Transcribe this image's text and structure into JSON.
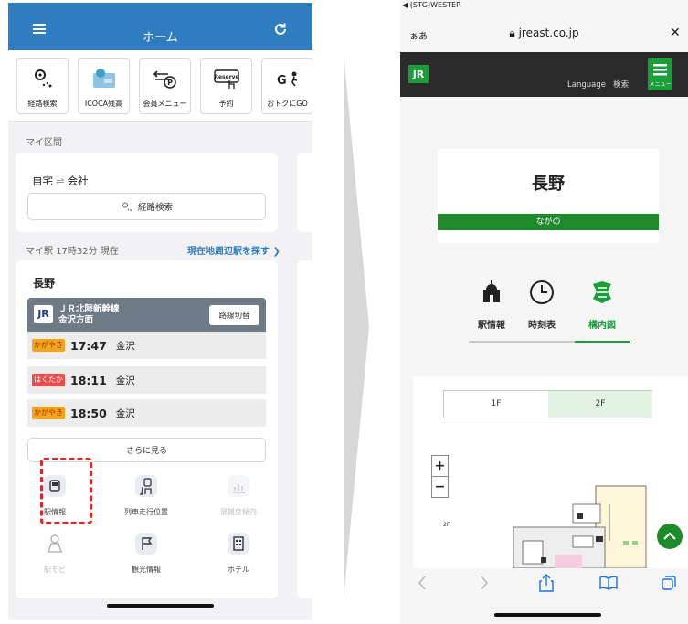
{
  "left_app": {
    "header": {
      "title": "ホーム"
    },
    "shortcuts": [
      {
        "label": "経路検索",
        "icon": "route-search-icon"
      },
      {
        "label": "ICOCA残高",
        "icon": "icoca-card-icon"
      },
      {
        "label": "会員メニュー",
        "icon": "member-menu-icon"
      },
      {
        "label": "予約",
        "icon": "reserve-icon"
      },
      {
        "label": "おトクにGO",
        "icon": "deal-go-icon"
      }
    ],
    "reserve_icon_text": "Reserve",
    "my_section": {
      "label": "マイ区間",
      "from": "自宅",
      "to": "会社",
      "arrow": "⇌",
      "route_button": "経路検索"
    },
    "my_station": {
      "label": "マイ駅",
      "time": "17時32分 現在",
      "nearby_link": "現在地周辺駅を探す"
    },
    "station": {
      "name": "長野",
      "line_name": "ＪＲ北陸新幹線",
      "direction": "金沢方面",
      "switch_button": "路線切替",
      "trains": [
        {
          "type": "かがやき",
          "time": "17:47",
          "dest": "金沢"
        },
        {
          "type": "はくたか",
          "time": "18:11",
          "dest": "金沢"
        },
        {
          "type": "かがやき",
          "time": "18:50",
          "dest": "金沢"
        }
      ],
      "more_button": "さらに見る"
    },
    "functions": [
      {
        "label": "駅情報",
        "icon": "station-info-icon",
        "enabled": true
      },
      {
        "label": "列車走行位置",
        "icon": "train-position-icon",
        "enabled": true
      },
      {
        "label": "混雑度傾向",
        "icon": "congestion-chart-icon",
        "enabled": false
      },
      {
        "label": "駅モビ",
        "icon": "eki-mobi-icon",
        "enabled": false
      },
      {
        "label": "観光情報",
        "icon": "sightseeing-flag-icon",
        "enabled": true
      },
      {
        "label": "ホテル",
        "icon": "hotel-icon",
        "enabled": true
      }
    ]
  },
  "right_browser": {
    "status_text": "◀ (STG)WESTER",
    "aa_label": "ぁあ",
    "url": "jreast.co.jp",
    "nav": {
      "language": "Language",
      "search": "検索",
      "menu": "メニュー"
    },
    "station_name": "長野",
    "station_kana": "ながの",
    "tabs": [
      {
        "label": "駅情報",
        "icon": "station-building-icon",
        "active": false
      },
      {
        "label": "時刻表",
        "icon": "clock-icon",
        "active": false
      },
      {
        "label": "構内図",
        "icon": "floor-map-icon",
        "active": true
      }
    ],
    "floors": [
      {
        "label": "1F",
        "active": false
      },
      {
        "label": "2F",
        "active": true
      }
    ],
    "zoom_in": "+",
    "zoom_out": "−",
    "map_floor_label": "2F"
  },
  "colors": {
    "app_blue": "#2f7dc0",
    "jr_green": "#1a9e3a",
    "highlight_red": "#e0252f",
    "kagayaki_badge": "#f2a516",
    "hakutaka_badge": "#e94c4c"
  }
}
